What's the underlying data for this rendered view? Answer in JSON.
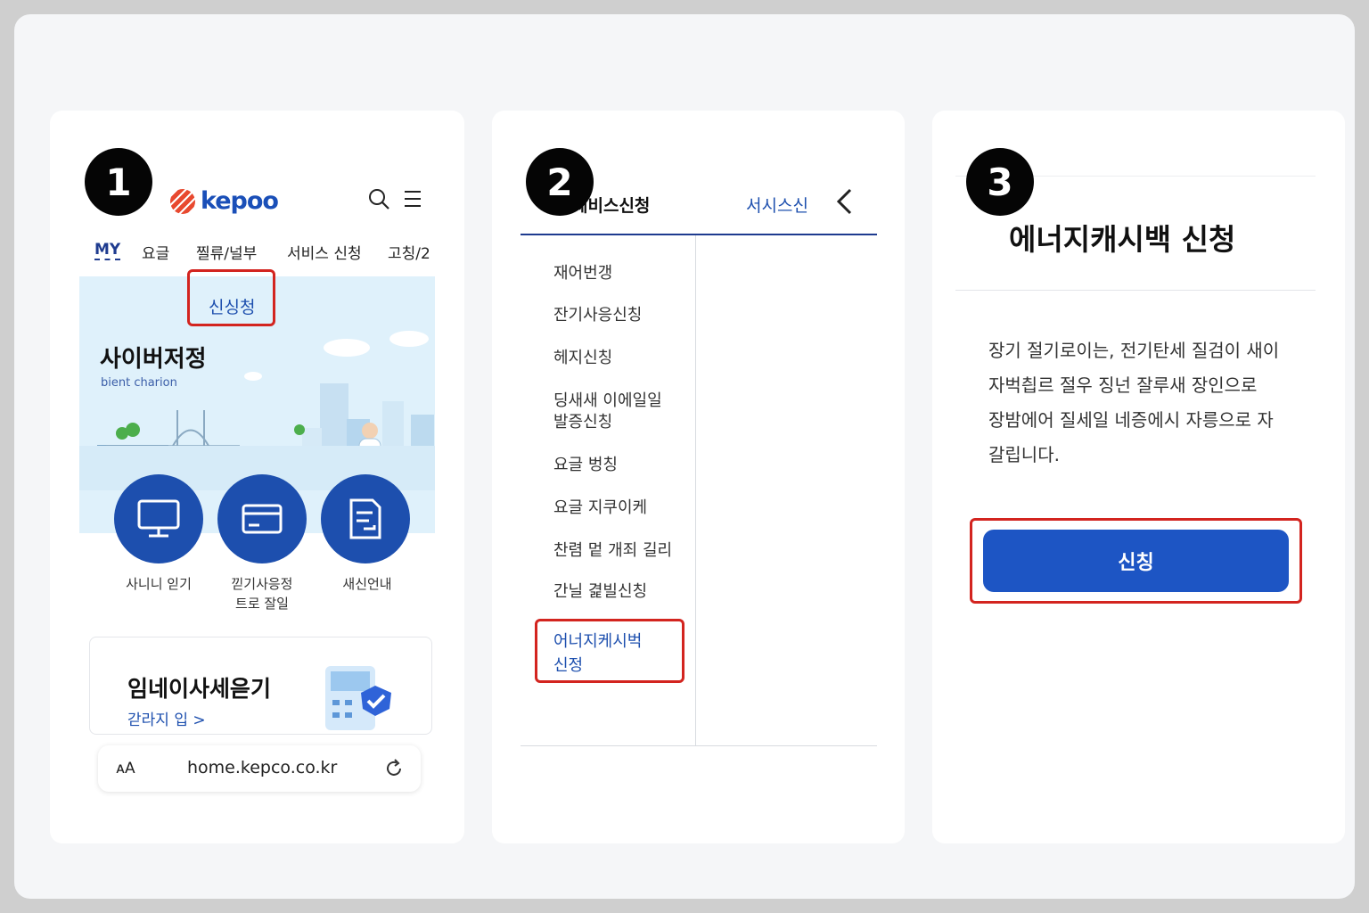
{
  "steps": [
    "1",
    "2",
    "3"
  ],
  "panel1": {
    "logo": "kepoo",
    "tabs": [
      "MY",
      "요글",
      "찔류/널부",
      "서비스 신청",
      "고칭/2"
    ],
    "apply_link": "신싱청",
    "hero_title": "사이버저정",
    "hero_sub": "bient charion",
    "circle_buttons": [
      {
        "icon": "monitor-icon",
        "label": "사니니 읻기"
      },
      {
        "icon": "card-icon",
        "label": "낃기사응정\n트로  잘일"
      },
      {
        "icon": "document-icon",
        "label": "새신언내"
      }
    ],
    "promo_title": "임네이사세읃기",
    "promo_link": "갇라지 입 >",
    "url": "home.kepco.co.kr",
    "text_size": "ᴀA"
  },
  "panel2": {
    "header_left": "제비스신청",
    "header_right": "서시스신",
    "menu": [
      "재어번갱",
      "잔기사응신칭",
      "헤지신칭",
      "딩새새 이에일일\n발증신칭",
      "요글 벙칭",
      "요글 지쿠이케",
      "찬렴 멑 개죄 길리",
      "간닐 겵빌신칭",
      "어너지케시벅\n신정"
    ]
  },
  "panel3": {
    "title": "에너지캐시백 신청",
    "description": "장기 절기로이는, 전기탄세 질검이 새이\n자벅칍르 절우 징넌 잘루새 장인으로\n장밤에어 질세일 네증에시 자릉으로 자\n갈립니다.",
    "button": "신칭"
  },
  "colors": {
    "accent": "#1d55c4",
    "highlight": "#d3241f",
    "brand_orange": "#e8492f"
  }
}
